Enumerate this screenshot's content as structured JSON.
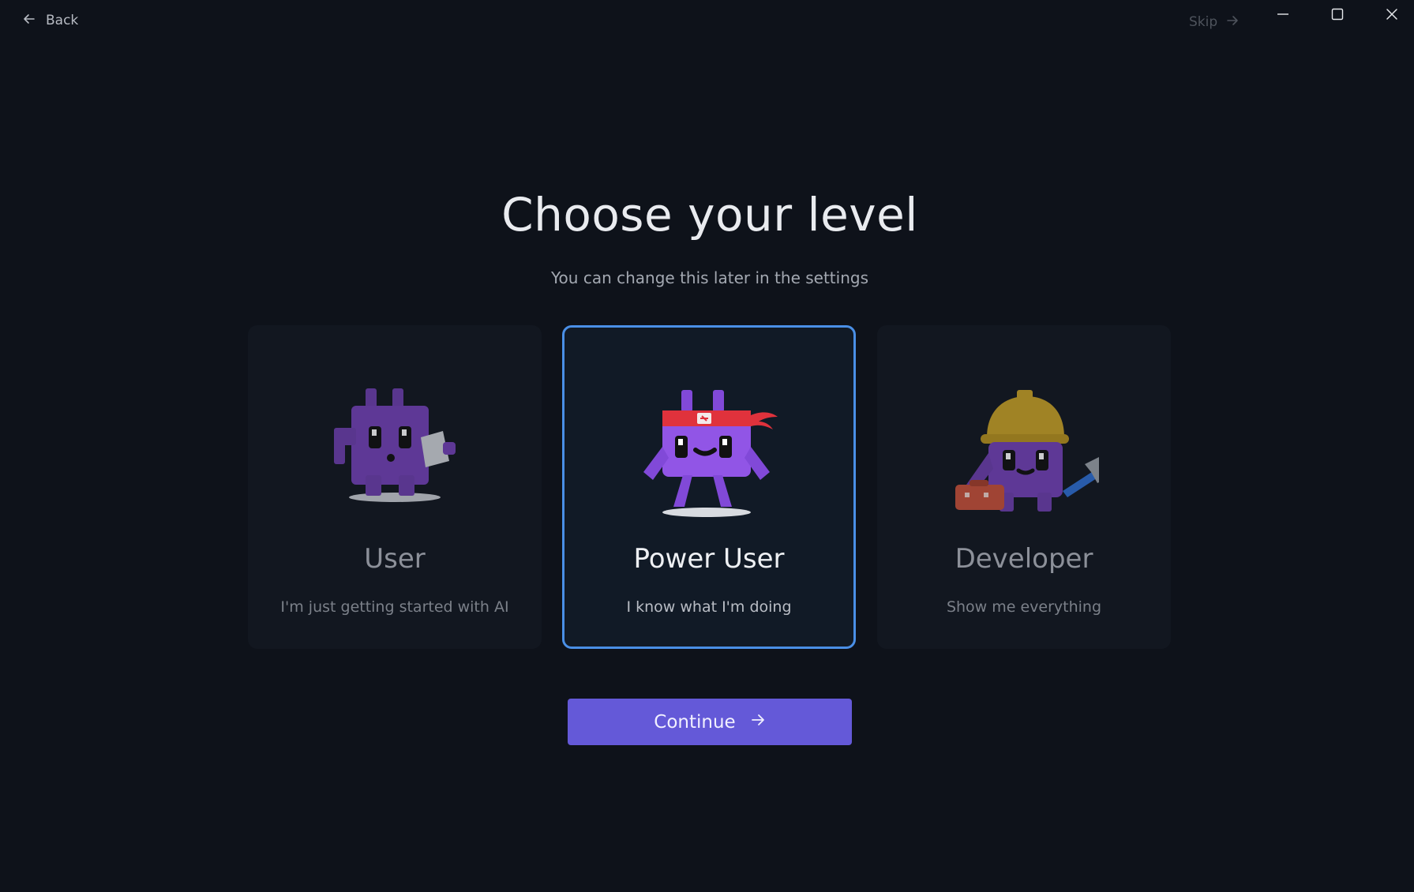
{
  "titlebar": {
    "back_label": "Back",
    "skip_label": "Skip"
  },
  "main": {
    "title": "Choose your level",
    "subtitle": "You can change this later in the settings",
    "continue_label": "Continue"
  },
  "levels": [
    {
      "title": "User",
      "description": "I'm just getting started with AI",
      "selected": false,
      "mascot": "purple-robot-mascot"
    },
    {
      "title": "Power User",
      "description": "I know what I'm doing",
      "selected": true,
      "mascot": "ninja-headband-mascot"
    },
    {
      "title": "Developer",
      "description": "Show me everything",
      "selected": false,
      "mascot": "hard-hat-hammer-mascot"
    }
  ],
  "colors": {
    "background": "#0e121a",
    "card": "#121720",
    "selected_border": "#4a8fe6",
    "accent_button": "#6459d8",
    "mascot_purple": "#7e4bc4"
  }
}
